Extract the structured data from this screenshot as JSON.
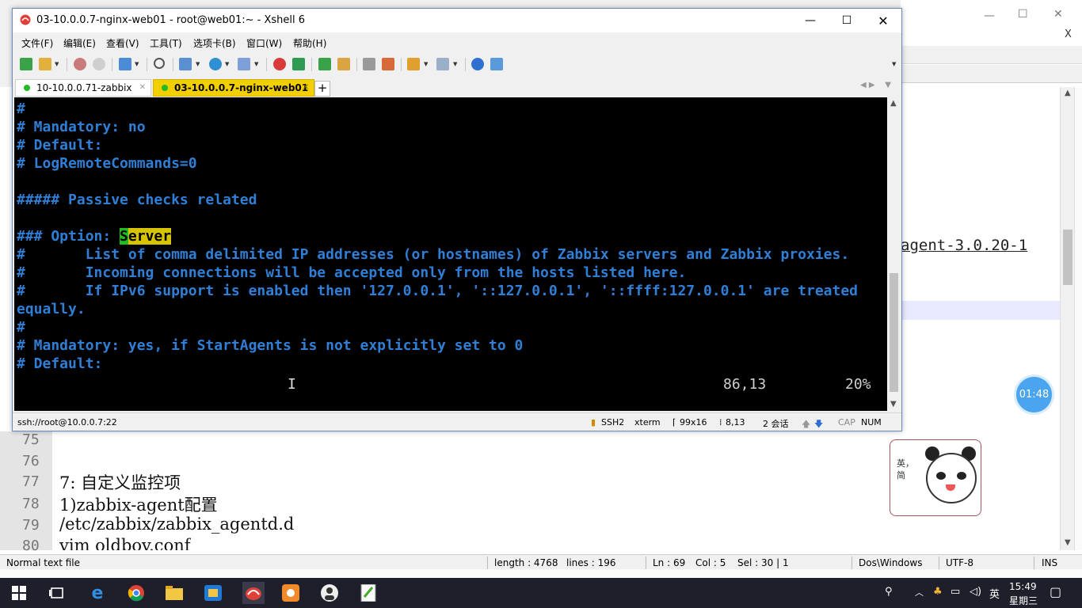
{
  "background_editor": {
    "agent_text": "agent-3.0.20-1",
    "gutter_numbers": [
      "75",
      "76",
      "77",
      "78",
      "79",
      "80"
    ],
    "code_lines": [
      "",
      "",
      "7: 自定义监控项",
      "1)zabbix-agent配置",
      "/etc/zabbix/zabbix_agentd.d",
      "vim oldboy.conf"
    ],
    "status": {
      "file_type": "Normal text file",
      "length": "length : 4768",
      "lines": "lines : 196",
      "ln": "Ln : 69",
      "col": "Col : 5",
      "sel": "Sel : 30 | 1",
      "eol": "Dos\\Windows",
      "encoding": "UTF-8",
      "mode": "INS"
    },
    "timer": "01:48",
    "sticker_text": "英，简"
  },
  "xshell": {
    "title": "03-10.0.0.7-nginx-web01 - root@web01:~ - Xshell 6",
    "menu": [
      "文件(F)",
      "编辑(E)",
      "查看(V)",
      "工具(T)",
      "选项卡(B)",
      "窗口(W)",
      "帮助(H)"
    ],
    "tabs": [
      {
        "label": "10-10.0.0.71-zabbix",
        "active": false
      },
      {
        "label": "03-10.0.0.7-nginx-web01",
        "active": true
      }
    ],
    "terminal_lines": [
      "#",
      "# Mandatory: no",
      "# Default:",
      "# LogRemoteCommands=0",
      "",
      "##### Passive checks related",
      "",
      "### Option: ",
      "#       List of comma delimited IP addresses (or hostnames) of Zabbix servers and Zabbix proxies.",
      "#       Incoming connections will be accepted only from the hosts listed here.",
      "#       If IPv6 support is enabled then '127.0.0.1', '::127.0.0.1', '::ffff:127.0.0.1' are treated",
      "equally.",
      "#",
      "# Mandatory: yes, if StartAgents is not explicitly set to 0",
      "# Default:"
    ],
    "search_highlight": "Server",
    "cursor_pos": "86,13",
    "scroll_percent": "20%",
    "status": {
      "connection": "ssh://root@10.0.0.7:22",
      "protocol": "SSH2",
      "term": "xterm",
      "size": "99x16",
      "pos": "8,13",
      "sessions": "2 会话",
      "cap": "CAP",
      "num": "NUM"
    }
  },
  "taskbar": {
    "time": "15:49",
    "day": "星期三",
    "ime": "英"
  },
  "colors": {
    "terminal_text": "#2f7fd6",
    "active_tab": "#f2cf00",
    "taskbar": "#1f1f2b"
  }
}
